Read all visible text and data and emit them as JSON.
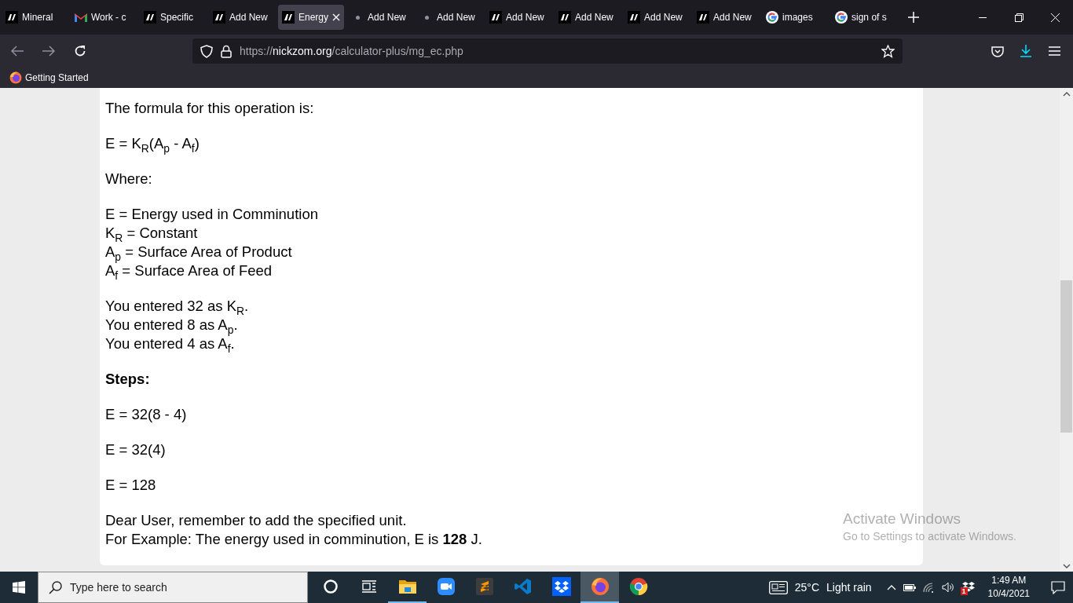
{
  "tabs": [
    {
      "title": "Mineral",
      "kind": "site",
      "selected": false
    },
    {
      "title": "Work - c",
      "kind": "mail",
      "selected": false
    },
    {
      "title": "Specific",
      "kind": "site",
      "selected": false
    },
    {
      "title": "Add New",
      "kind": "site",
      "selected": false
    },
    {
      "title": "Energy",
      "kind": "site",
      "selected": true
    },
    {
      "title": "Add New",
      "kind": "dot",
      "selected": false
    },
    {
      "title": "Add New",
      "kind": "dot",
      "selected": false
    },
    {
      "title": "Add New",
      "kind": "site",
      "selected": false
    },
    {
      "title": "Add New",
      "kind": "site",
      "selected": false
    },
    {
      "title": "Add New",
      "kind": "site",
      "selected": false
    },
    {
      "title": "Add New",
      "kind": "site",
      "selected": false
    },
    {
      "title": "images",
      "kind": "google",
      "selected": false
    },
    {
      "title": "sign of s",
      "kind": "google",
      "selected": false
    }
  ],
  "address_bar": {
    "scheme": "https://",
    "domain": "nickzom.org",
    "path": "/calculator-plus/mg_ec.php"
  },
  "bookmarks": [
    "Getting Started"
  ],
  "content": [
    {
      "kind": "paragraph",
      "lines": [
        "The formula for this operation is:"
      ]
    },
    {
      "kind": "paragraph",
      "lines": [
        "E = K$_{R}$(A$_{p}$ - A$_{f}$)"
      ]
    },
    {
      "kind": "paragraph",
      "lines": [
        "Where:"
      ]
    },
    {
      "kind": "paragraph",
      "lines": [
        "E = Energy used in Comminution",
        "K$_{R}$ = Constant",
        "A$_{p}$ = Surface Area of Product",
        "A$_{f}$ = Surface Area of Feed"
      ]
    },
    {
      "kind": "paragraph",
      "lines": [
        "You entered 32 as K$_{R}$.",
        "You entered 8 as A$_{p}$.",
        "You entered 4 as A$_{f}$."
      ]
    },
    {
      "kind": "heading",
      "lines": [
        "Steps:"
      ]
    },
    {
      "kind": "paragraph",
      "lines": [
        "E = 32(8 - 4)"
      ]
    },
    {
      "kind": "paragraph",
      "lines": [
        "E = 32(4)"
      ]
    },
    {
      "kind": "paragraph",
      "lines": [
        "E = 128"
      ]
    },
    {
      "kind": "paragraph",
      "lines": [
        "Dear User, remember to add the specified unit.",
        "For Example: The energy used in comminution, E is **128** J."
      ]
    }
  ],
  "activation_notice": {
    "title": "Activate Windows",
    "subtitle": "Go to Settings to activate Windows."
  },
  "taskbar": {
    "search": {
      "placeholder": "Type here to search"
    },
    "apps": [
      {
        "kind": "cortana",
        "running": false,
        "selected": false
      },
      {
        "kind": "taskview",
        "running": false,
        "selected": false
      },
      {
        "kind": "explorer",
        "running": true,
        "selected": false
      },
      {
        "kind": "zoom",
        "running": false,
        "selected": false
      },
      {
        "kind": "sublime",
        "running": false,
        "selected": false
      },
      {
        "kind": "vscode",
        "running": false,
        "selected": false
      },
      {
        "kind": "dropbox",
        "running": false,
        "selected": false
      },
      {
        "kind": "firefox",
        "running": true,
        "selected": true
      },
      {
        "kind": "chrome",
        "running": false,
        "selected": false
      }
    ],
    "weather": {
      "temperature": "25°C",
      "condition": "Light rain"
    },
    "tray_badge": "1",
    "time": "1:49 AM",
    "date": "10/4/2021"
  }
}
